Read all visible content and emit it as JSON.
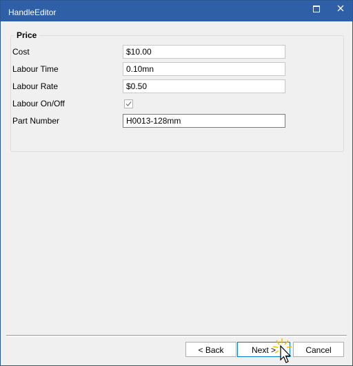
{
  "window": {
    "title": "HandleEditor"
  },
  "group": {
    "title": "Price"
  },
  "fields": {
    "cost": {
      "label": "Cost",
      "value": "$10.00"
    },
    "labour_time": {
      "label": "Labour Time",
      "value": "0.10mn"
    },
    "labour_rate": {
      "label": "Labour Rate",
      "value": "$0.50"
    },
    "labour_onoff": {
      "label": "Labour On/Off",
      "checked": true
    },
    "part_number": {
      "label": "Part Number",
      "value": "H0013-128mm"
    }
  },
  "buttons": {
    "back": "< Back",
    "next": "Next >",
    "cancel": "Cancel"
  },
  "icons": {
    "maximize": "maximize-icon",
    "close": "close-icon",
    "checkmark": "checkmark-icon",
    "cursor": "mouse-pointer-icon"
  },
  "colors": {
    "titlebar": "#2f5fa7",
    "accent": "#0078d7"
  }
}
